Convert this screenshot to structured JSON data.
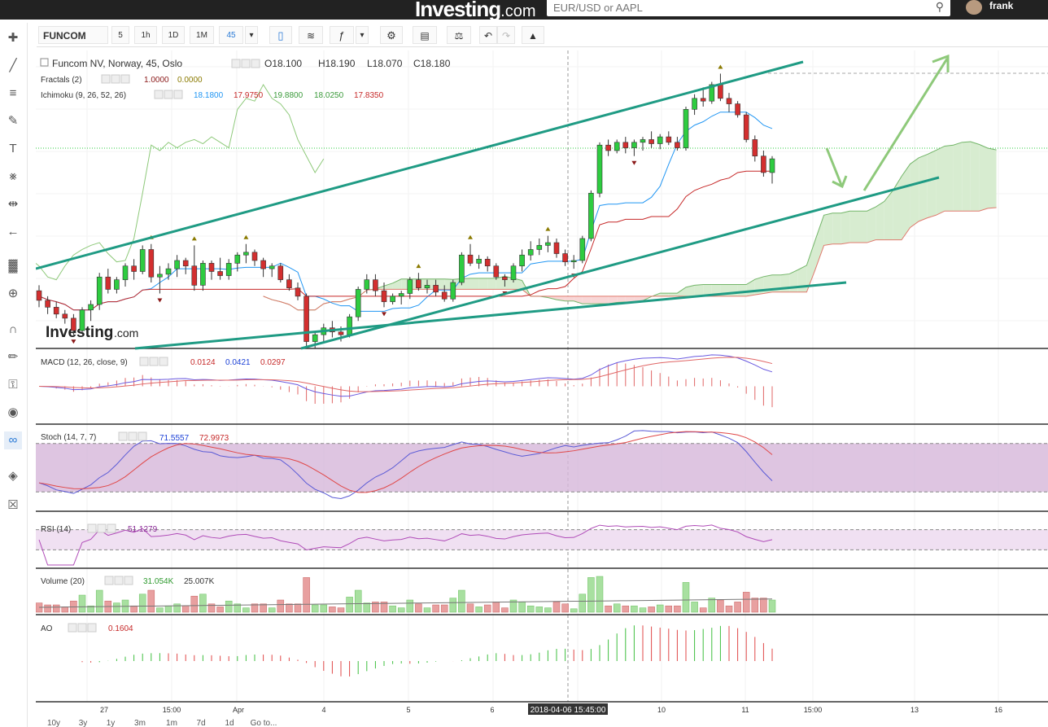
{
  "topbar": {
    "logo_text": "Investing",
    "logo_suffix": ".com",
    "search_placeholder": "EUR/USD or AAPL",
    "username": "frank"
  },
  "toolbar": {
    "symbol": "FUNCOM",
    "intervals": [
      "5",
      "1h",
      "1D",
      "1M",
      "45"
    ],
    "active_interval": "45"
  },
  "left_tools": [
    "crosshair-icon",
    "trend-line-icon",
    "fib-icon",
    "brush-icon",
    "text-icon",
    "pattern-icon",
    "measure-icon",
    "back-arrow-icon",
    "bars-icon",
    "zoom-in-icon",
    "magnet-icon",
    "lock-drawing-icon",
    "unlock-icon",
    "eye-icon",
    "link-icon",
    "layers-icon",
    "trash-icon"
  ],
  "legend": {
    "title": "Funcom NV, Norway, 45, Oslo",
    "open": "O18.100",
    "high": "H18.190",
    "low": "L18.070",
    "close": "C18.180",
    "fractals_label": "Fractals (2)",
    "fractals_values": [
      "1.0000",
      "0.0000"
    ],
    "ichimoku_label": "Ichimoku (9, 26, 52, 26)",
    "ichimoku_values": [
      "18.1800",
      "17.9750",
      "19.8800",
      "18.0250",
      "17.8350"
    ],
    "watermark": "Investing",
    "watermark_suffix": ".com"
  },
  "panes": {
    "macd": {
      "label": "MACD (12, 26, close, 9)",
      "values": [
        "0.0124",
        "0.0421",
        "0.0297"
      ]
    },
    "stoch": {
      "label": "Stoch (14, 7, 7)",
      "values": [
        "71.5557",
        "72.9973"
      ]
    },
    "rsi": {
      "label": "RSI (14)",
      "values": [
        "51.1279"
      ]
    },
    "volume": {
      "label": "Volume (20)",
      "values": [
        "31.054K",
        "25.007K"
      ]
    },
    "ao": {
      "label": "AO",
      "values": [
        "0.1604"
      ]
    }
  },
  "x_axis": {
    "ticks": [
      "27",
      "15:00",
      "Apr",
      "4",
      "5",
      "6",
      "10",
      "11",
      "15:00",
      "13",
      "16"
    ],
    "crosshair_label": "2018-04-06 15:45:00"
  },
  "range_buttons": [
    "10y",
    "3y",
    "1y",
    "3m",
    "1m",
    "7d",
    "1d",
    "Go to..."
  ],
  "colors": {
    "up": "#2ecc40",
    "down": "#d32f2f",
    "trendline": "#1f9b84",
    "arrow": "#8ec97a",
    "tenkan": "#2196f3",
    "kijun": "#c62828",
    "cloud_up": "#d7ecd0",
    "cloud_down": "#f8d6d6",
    "stoch_band": "#d6b6d9",
    "rsi_band": "#f0e0f2"
  },
  "chart_data": {
    "type": "candlestick",
    "ohlc": [
      [
        17.62,
        17.66,
        17.5,
        17.55
      ],
      [
        17.55,
        17.58,
        17.45,
        17.5
      ],
      [
        17.5,
        17.54,
        17.42,
        17.45
      ],
      [
        17.45,
        17.48,
        17.38,
        17.42
      ],
      [
        17.42,
        17.45,
        17.3,
        17.33
      ],
      [
        17.33,
        17.5,
        17.31,
        17.48
      ],
      [
        17.48,
        17.55,
        17.4,
        17.52
      ],
      [
        17.52,
        17.75,
        17.48,
        17.72
      ],
      [
        17.72,
        17.78,
        17.6,
        17.63
      ],
      [
        17.63,
        17.72,
        17.6,
        17.7
      ],
      [
        17.7,
        17.82,
        17.65,
        17.8
      ],
      [
        17.8,
        17.85,
        17.7,
        17.76
      ],
      [
        17.76,
        17.95,
        17.74,
        17.92
      ],
      [
        17.92,
        17.96,
        17.68,
        17.72
      ],
      [
        17.72,
        17.8,
        17.6,
        17.74
      ],
      [
        17.74,
        17.82,
        17.7,
        17.78
      ],
      [
        17.78,
        17.88,
        17.72,
        17.84
      ],
      [
        17.84,
        17.86,
        17.74,
        17.8
      ],
      [
        17.8,
        17.95,
        17.62,
        17.66
      ],
      [
        17.66,
        17.84,
        17.62,
        17.82
      ],
      [
        17.82,
        17.84,
        17.7,
        17.76
      ],
      [
        17.76,
        17.86,
        17.7,
        17.73
      ],
      [
        17.73,
        17.85,
        17.7,
        17.82
      ],
      [
        17.82,
        17.9,
        17.76,
        17.88
      ],
      [
        17.88,
        17.96,
        17.82,
        17.9
      ],
      [
        17.9,
        17.92,
        17.8,
        17.84
      ],
      [
        17.84,
        17.86,
        17.72,
        17.78
      ],
      [
        17.78,
        17.82,
        17.72,
        17.8
      ],
      [
        17.8,
        17.82,
        17.68,
        17.7
      ],
      [
        17.7,
        17.74,
        17.62,
        17.64
      ],
      [
        17.64,
        17.68,
        17.55,
        17.58
      ],
      [
        17.58,
        17.6,
        17.2,
        17.25
      ],
      [
        17.25,
        17.32,
        17.2,
        17.3
      ],
      [
        17.3,
        17.38,
        17.24,
        17.35
      ],
      [
        17.35,
        17.4,
        17.28,
        17.32
      ],
      [
        17.32,
        17.36,
        17.25,
        17.3
      ],
      [
        17.3,
        17.45,
        17.28,
        17.43
      ],
      [
        17.43,
        17.65,
        17.4,
        17.63
      ],
      [
        17.63,
        17.74,
        17.6,
        17.7
      ],
      [
        17.7,
        17.74,
        17.58,
        17.62
      ],
      [
        17.62,
        17.68,
        17.5,
        17.54
      ],
      [
        17.54,
        17.6,
        17.52,
        17.58
      ],
      [
        17.58,
        17.62,
        17.52,
        17.6
      ],
      [
        17.6,
        17.72,
        17.56,
        17.7
      ],
      [
        17.7,
        17.75,
        17.62,
        17.64
      ],
      [
        17.64,
        17.7,
        17.6,
        17.66
      ],
      [
        17.66,
        17.7,
        17.58,
        17.61
      ],
      [
        17.61,
        17.66,
        17.54,
        17.56
      ],
      [
        17.56,
        17.7,
        17.54,
        17.68
      ],
      [
        17.68,
        17.9,
        17.66,
        17.88
      ],
      [
        17.88,
        17.96,
        17.8,
        17.82
      ],
      [
        17.82,
        17.88,
        17.78,
        17.85
      ],
      [
        17.85,
        17.87,
        17.76,
        17.8
      ],
      [
        17.8,
        17.82,
        17.7,
        17.72
      ],
      [
        17.72,
        17.74,
        17.65,
        17.7
      ],
      [
        17.7,
        17.82,
        17.68,
        17.8
      ],
      [
        17.8,
        17.92,
        17.76,
        17.88
      ],
      [
        17.88,
        17.98,
        17.84,
        17.92
      ],
      [
        17.92,
        18.0,
        17.88,
        17.95
      ],
      [
        17.95,
        18.02,
        17.9,
        17.97
      ],
      [
        17.97,
        18.0,
        17.86,
        17.89
      ],
      [
        17.89,
        17.92,
        17.8,
        17.83
      ],
      [
        17.83,
        17.88,
        17.78,
        17.84
      ],
      [
        17.84,
        18.02,
        17.82,
        18.0
      ],
      [
        18.0,
        18.35,
        17.98,
        18.33
      ],
      [
        18.33,
        18.7,
        18.3,
        18.68
      ],
      [
        18.68,
        18.72,
        18.6,
        18.64
      ],
      [
        18.64,
        18.72,
        18.62,
        18.7
      ],
      [
        18.7,
        18.74,
        18.62,
        18.66
      ],
      [
        18.66,
        18.72,
        18.6,
        18.7
      ],
      [
        18.7,
        18.74,
        18.64,
        18.72
      ],
      [
        18.72,
        18.78,
        18.66,
        18.69
      ],
      [
        18.69,
        18.76,
        18.65,
        18.74
      ],
      [
        18.74,
        18.78,
        18.68,
        18.7
      ],
      [
        18.7,
        18.74,
        18.64,
        18.66
      ],
      [
        18.66,
        18.96,
        18.64,
        18.94
      ],
      [
        18.94,
        19.05,
        18.9,
        19.02
      ],
      [
        19.02,
        19.1,
        18.96,
        19.0
      ],
      [
        19.0,
        19.14,
        18.98,
        19.12
      ],
      [
        19.12,
        19.2,
        19.0,
        19.02
      ],
      [
        19.02,
        19.06,
        18.92,
        18.98
      ],
      [
        18.98,
        19.0,
        18.88,
        18.9
      ],
      [
        18.9,
        18.92,
        18.7,
        18.72
      ],
      [
        18.72,
        18.75,
        18.56,
        18.6
      ],
      [
        18.6,
        18.64,
        18.45,
        18.48
      ],
      [
        18.48,
        18.6,
        18.4,
        18.58
      ]
    ],
    "y_range": [
      17.2,
      19.25
    ],
    "x_ticks": [
      "27",
      "15:00",
      "Apr",
      "4",
      "5",
      "6",
      "10",
      "11",
      "15:00",
      "13",
      "16"
    ]
  }
}
